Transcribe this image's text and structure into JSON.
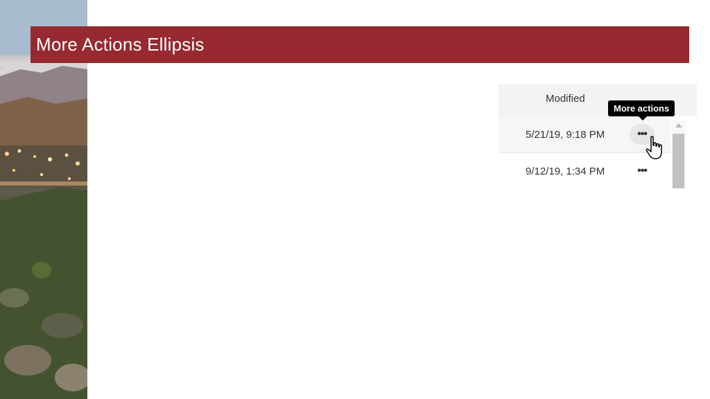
{
  "slide": {
    "title": "More Actions Ellipsis"
  },
  "ui": {
    "column_header": "Modified",
    "tooltip": "More actions",
    "rows": [
      {
        "modified": "5/21/19, 9:18 PM",
        "action_icon": "ellipsis-icon",
        "hovered": true
      },
      {
        "modified": "9/12/19, 1:34 PM",
        "action_icon": "ellipsis-icon",
        "hovered": false
      }
    ],
    "ellipsis_glyph": "•••"
  },
  "colors": {
    "title_bar": "#962a30",
    "tooltip_bg": "#000000",
    "header_bg": "#f3f3f3"
  },
  "icons": {
    "cursor": "hand-pointer-icon",
    "scroll_up": "scroll-up-arrow-icon"
  }
}
